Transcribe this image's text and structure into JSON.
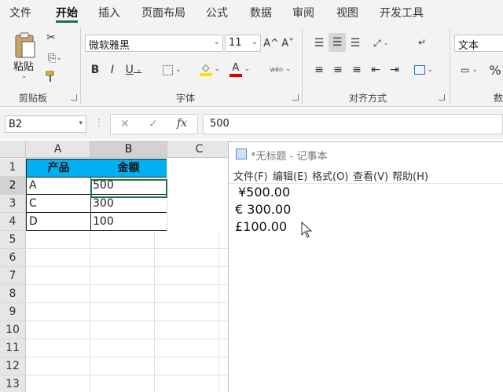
{
  "ribbon_tabs": [
    "文件",
    "开始",
    "插入",
    "页面布局",
    "公式",
    "数据",
    "审阅",
    "视图",
    "开发工具"
  ],
  "active_tab": "开始",
  "clipboard": {
    "paste_label": "粘贴",
    "group_label": "剪贴板"
  },
  "font": {
    "name": "微软雅黑",
    "size": "11",
    "group_label": "字体",
    "bold": "B",
    "italic": "I",
    "underline": "U",
    "grow": "A^",
    "shrink": "A˅",
    "phonetic": "wén"
  },
  "alignment": {
    "group_label": "对齐方式"
  },
  "number": {
    "format": "文本",
    "group_label": "数",
    "percent": "%"
  },
  "formula_bar": {
    "name_box": "B2",
    "cancel": "✕",
    "enter": "✓",
    "fx": "fx",
    "value": "500"
  },
  "sheet": {
    "columns": [
      "A",
      "B",
      "C"
    ],
    "rows": [
      "1",
      "2",
      "3",
      "4",
      "5",
      "6",
      "7",
      "8",
      "9",
      "10",
      "11",
      "12",
      "13"
    ],
    "header": {
      "a1": "产品",
      "b1": "金额"
    },
    "data": [
      {
        "product": "A",
        "amount": "500"
      },
      {
        "product": "C",
        "amount": "300"
      },
      {
        "product": "D",
        "amount": "100"
      }
    ]
  },
  "notepad": {
    "title": "*无标题 - 记事本",
    "menu": [
      "文件(F)",
      "编辑(E)",
      "格式(O)",
      "查看(V)",
      "帮助(H)"
    ],
    "lines": [
      "¥500.00",
      "€ 300.00",
      "£100.00"
    ]
  },
  "colors": {
    "accent": "#217346",
    "header_fill": "#00b0f0",
    "font_color_bar": "#e00000",
    "highlight_bar": "#ffe000"
  }
}
